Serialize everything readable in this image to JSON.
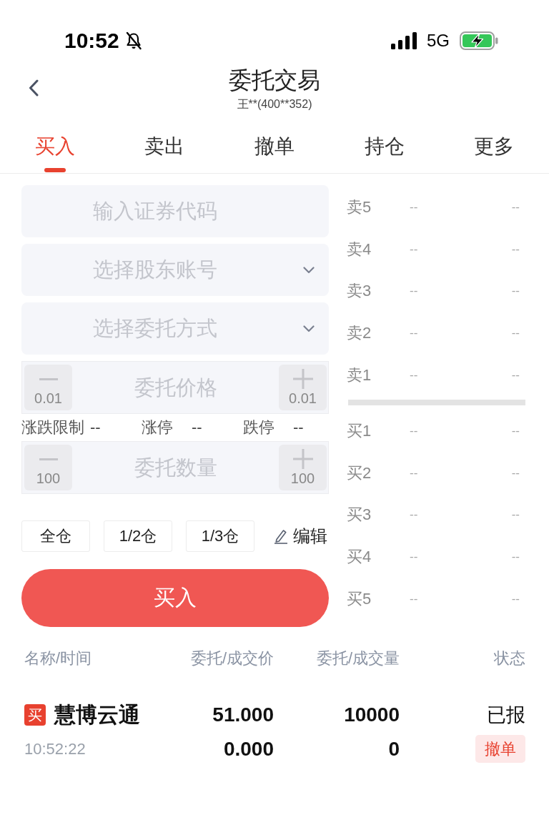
{
  "status_bar": {
    "time": "10:52",
    "silent": true,
    "network": "5G",
    "charging": true
  },
  "header": {
    "title": "委托交易",
    "subtitle": "王**(400**352)"
  },
  "tabs": [
    {
      "label": "买入",
      "selected": true
    },
    {
      "label": "卖出",
      "selected": false
    },
    {
      "label": "撤单",
      "selected": false
    },
    {
      "label": "持仓",
      "selected": false
    },
    {
      "label": "更多",
      "selected": false
    }
  ],
  "order_form": {
    "fields": [
      {
        "kind": "input",
        "placeholder": "输入证券代码"
      },
      {
        "kind": "select",
        "placeholder": "选择股东账号"
      },
      {
        "kind": "select",
        "placeholder": "选择委托方式"
      },
      {
        "kind": "stepper",
        "placeholder": "委托价格",
        "decrement": "0.01",
        "increment": "0.01"
      },
      {
        "kind": "limits",
        "items": [
          {
            "label": "涨跌限制",
            "value": "--"
          },
          {
            "label": "涨停",
            "value": "--"
          },
          {
            "label": "跌停",
            "value": "--"
          }
        ]
      },
      {
        "kind": "stepper",
        "placeholder": "委托数量",
        "decrement": "100",
        "increment": "100"
      }
    ],
    "position_buttons": [
      "全仓",
      "1/2仓",
      "1/3仓"
    ],
    "edit_link": "编辑",
    "submit_button": "买入"
  },
  "order_book": {
    "asks": [
      {
        "label": "卖5",
        "price": "--",
        "volume": "--"
      },
      {
        "label": "卖4",
        "price": "--",
        "volume": "--"
      },
      {
        "label": "卖3",
        "price": "--",
        "volume": "--"
      },
      {
        "label": "卖2",
        "price": "--",
        "volume": "--"
      },
      {
        "label": "卖1",
        "price": "--",
        "volume": "--"
      }
    ],
    "bids": [
      {
        "label": "买1",
        "price": "--",
        "volume": "--"
      },
      {
        "label": "买2",
        "price": "--",
        "volume": "--"
      },
      {
        "label": "买3",
        "price": "--",
        "volume": "--"
      },
      {
        "label": "买4",
        "price": "--",
        "volume": "--"
      },
      {
        "label": "买5",
        "price": "--",
        "volume": "--"
      }
    ]
  },
  "orders": {
    "columns": [
      "名称/时间",
      "委托/成交价",
      "委托/成交量",
      "状态"
    ],
    "rows": [
      {
        "side": "买",
        "name": "慧博云通",
        "time": "10:52:22",
        "order_price": "51.000",
        "deal_price": "0.000",
        "order_volume": "10000",
        "deal_volume": "0",
        "status": "已报",
        "action": "撤单"
      }
    ]
  }
}
